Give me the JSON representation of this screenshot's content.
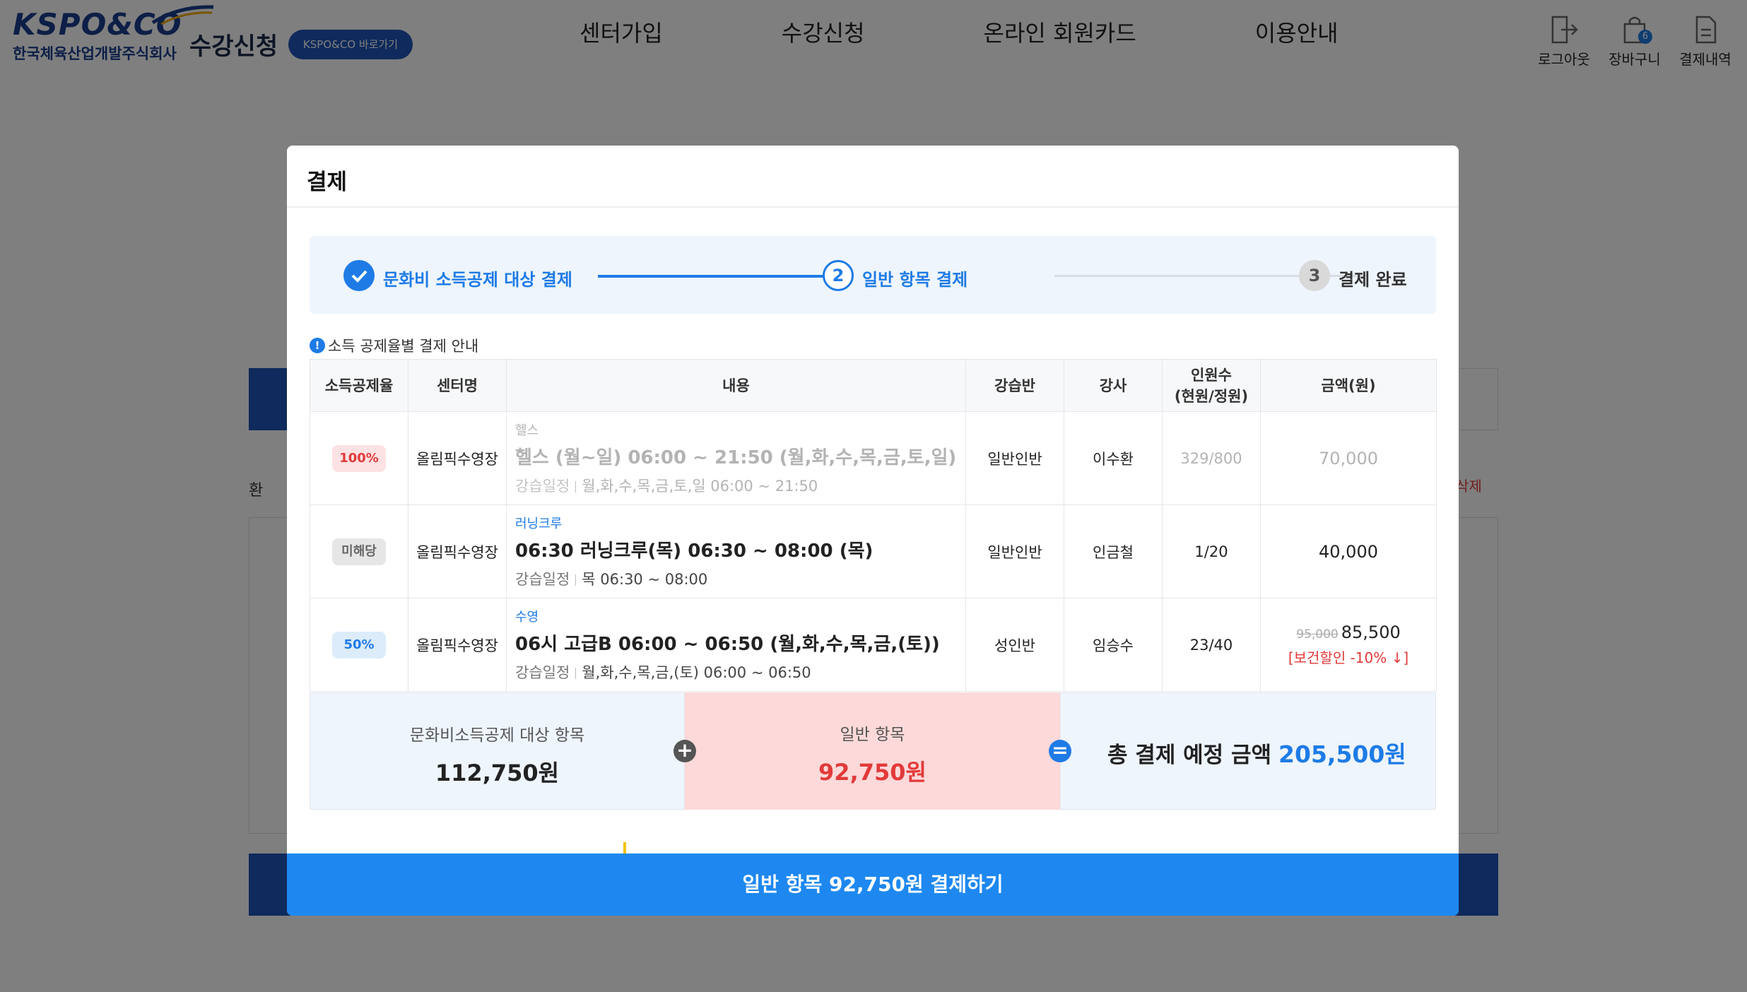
{
  "header": {
    "logo_text": "KSPO&CO",
    "logo_subtitle": "한국체육산업개발주식회사",
    "site_title": "수강신청",
    "shortcut_label": "KSPO&CO 바로가기",
    "nav": [
      "센터가입",
      "수강신청",
      "온라인 회원카드",
      "이용안내"
    ],
    "utilities": [
      {
        "label": "로그아웃",
        "icon": "logout-icon"
      },
      {
        "label": "장바구니",
        "icon": "cart-icon",
        "badge": "6"
      },
      {
        "label": "결제내역",
        "icon": "receipt-icon"
      }
    ]
  },
  "background": {
    "info_text": "환",
    "delete_label": "삭제"
  },
  "modal": {
    "title": "결제",
    "steps": [
      {
        "number": "",
        "label": "문화비 소득공제 대상 결제",
        "state": "done"
      },
      {
        "number": "2",
        "label": "일반 항목 결제",
        "state": "current"
      },
      {
        "number": "3",
        "label": "결제 완료",
        "state": "pending"
      }
    ],
    "guide_icon": "!",
    "guide_text": "소득 공제율별 결제 안내",
    "table": {
      "headers": [
        "소득공제율",
        "센터명",
        "내용",
        "강습반",
        "강사",
        "인원수\n(현원/정원)",
        "금액(원)"
      ],
      "rows": [
        {
          "rate": "100%",
          "center": "올림픽수영장",
          "category": "헬스",
          "program": "헬스 (월~일) 06:00 ~ 21:50 (월,화,수,목,금,토,일)",
          "schedule_label": "강습일정",
          "schedule": "월,화,수,목,금,토,일 06:00 ~ 21:50",
          "class": "일반인반",
          "instructor": "이수환",
          "count": "329/800",
          "amount": "70,000",
          "amount_original": "",
          "discount": ""
        },
        {
          "rate": "미해당",
          "center": "올림픽수영장",
          "category": "러닝크루",
          "program": "06:30 러닝크루(목) 06:30 ~ 08:00 (목)",
          "schedule_label": "강습일정",
          "schedule": "목 06:30 ~ 08:00",
          "class": "일반인반",
          "instructor": "인금철",
          "count": "1/20",
          "amount": "40,000",
          "amount_original": "",
          "discount": ""
        },
        {
          "rate": "50%",
          "center": "올림픽수영장",
          "category": "수영",
          "program": "06시 고급B 06:00 ~ 06:50 (월,화,수,목,금,(토))",
          "schedule_label": "강습일정",
          "schedule": "월,화,수,목,금,(토) 06:00 ~ 06:50",
          "class": "성인반",
          "instructor": "임승수",
          "count": "23/40",
          "amount": "85,500",
          "amount_original": "95,000",
          "discount": "[보건할인 -10% ↓]"
        }
      ]
    },
    "summary": {
      "deductible_label": "문화비소득공제 대상 항목",
      "deductible_value": "112,750원",
      "general_label": "일반 항목",
      "general_value": "92,750원",
      "plus": "+",
      "equals": "=",
      "total_label": "총 결제 예정 금액",
      "total_value": "205,500원"
    },
    "pay_button": "일반 항목 92,750원 결제하기"
  },
  "colors": {
    "primary": "#1e7be6",
    "pay_button": "#1e88f0",
    "danger": "#e23a3a",
    "brand": "#1b3f8f"
  }
}
